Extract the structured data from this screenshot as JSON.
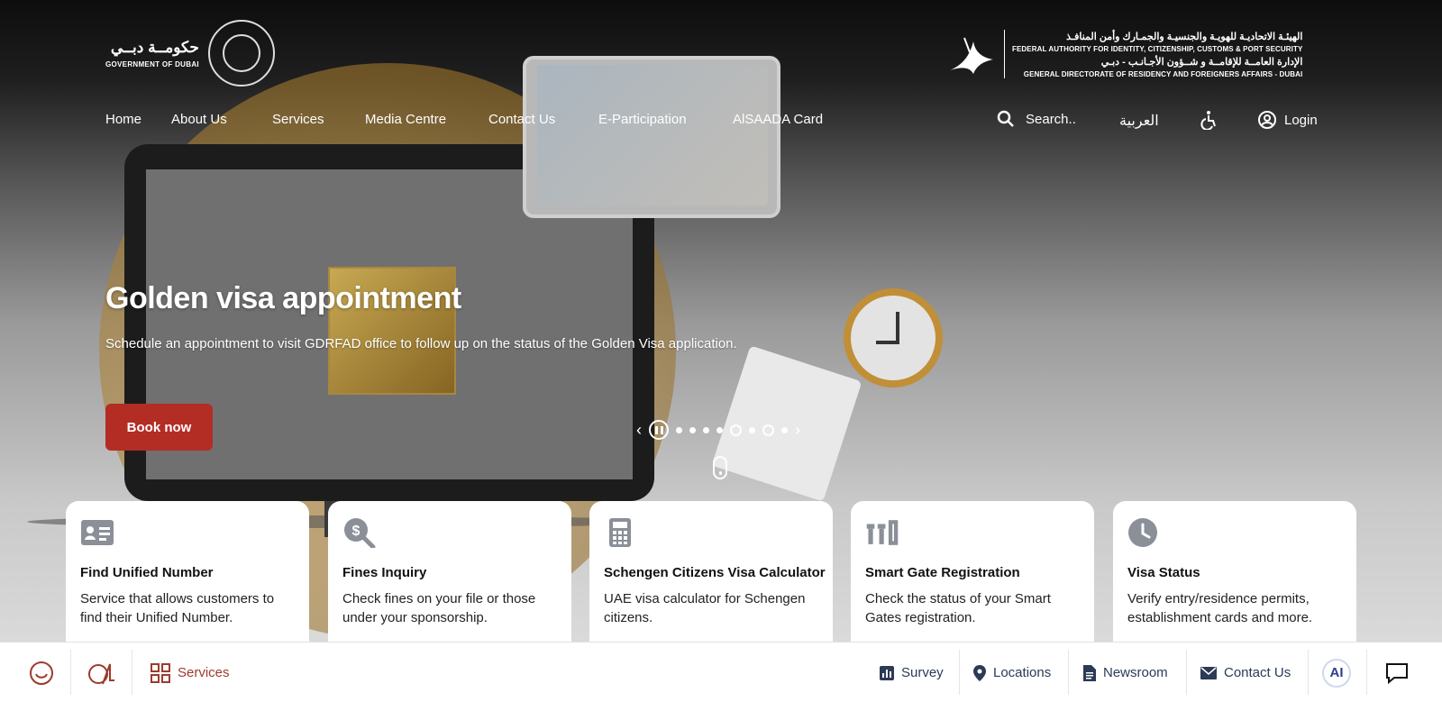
{
  "header": {
    "dubai_gov_ar": "حكومــة دبــي",
    "dubai_gov_en": "GOVERNMENT OF DUBAI",
    "ica_line1_ar": "الهيئـة الاتحاديـة للهويـة والجنسيـة والجمـارك وأمن المنافـذ",
    "ica_line1_en": "FEDERAL AUTHORITY FOR IDENTITY, CITIZENSHIP, CUSTOMS & PORT SECURITY",
    "ica_line2_ar": "الإدارة العامــة للإقامــة و شــؤون الأجـانـب - دبـي",
    "ica_line2_en": "GENERAL DIRECTORATE OF RESIDENCY AND FOREIGNERS AFFAIRS - DUBAI"
  },
  "nav": {
    "items": [
      "Home",
      "About Us",
      "Services",
      "Media Centre",
      "Contact Us",
      "E-Participation",
      "AlSAADA Card"
    ],
    "search_label": "Search..",
    "language_label": "العربية",
    "login_label": "Login"
  },
  "hero": {
    "title": "Golden visa appointment",
    "description": "Schedule an appointment to visit GDRFAD office to follow up on the status of the Golden Visa application.",
    "cta_label": "Book now",
    "slide_count": 8,
    "active_slide": 5
  },
  "cards": [
    {
      "icon": "id-card-icon",
      "title": "Find Unified Number",
      "desc_line1": "Service that allows customers to",
      "desc_line2": "find their Unified Number."
    },
    {
      "icon": "fines-search-icon",
      "title": "Fines Inquiry",
      "desc_line1": "Check fines on your file or those",
      "desc_line2": "under your sponsorship."
    },
    {
      "icon": "calculator-icon",
      "title": "Schengen Citizens Visa Calculator",
      "desc_line1": "UAE visa calculator for Schengen",
      "desc_line2": "citizens."
    },
    {
      "icon": "smart-gate-icon",
      "title": "Smart Gate Registration",
      "desc_line1": "Check the status of your Smart",
      "desc_line2": "Gates registration."
    },
    {
      "icon": "clock-icon",
      "title": "Visa Status",
      "desc_line1": "Verify entry/residence permits,",
      "desc_line2": "establishment cards and more."
    }
  ],
  "bottom_bar": {
    "services_label": "Services",
    "survey_label": "Survey",
    "locations_label": "Locations",
    "newsroom_label": "Newsroom",
    "contact_label": "Contact Us",
    "ai_label": "AI"
  },
  "colors": {
    "accent_red": "#b32d24",
    "bottom_text": "#2b3a55",
    "services_red": "#9e3a2d",
    "card_icon_gray": "#8a8f98"
  }
}
